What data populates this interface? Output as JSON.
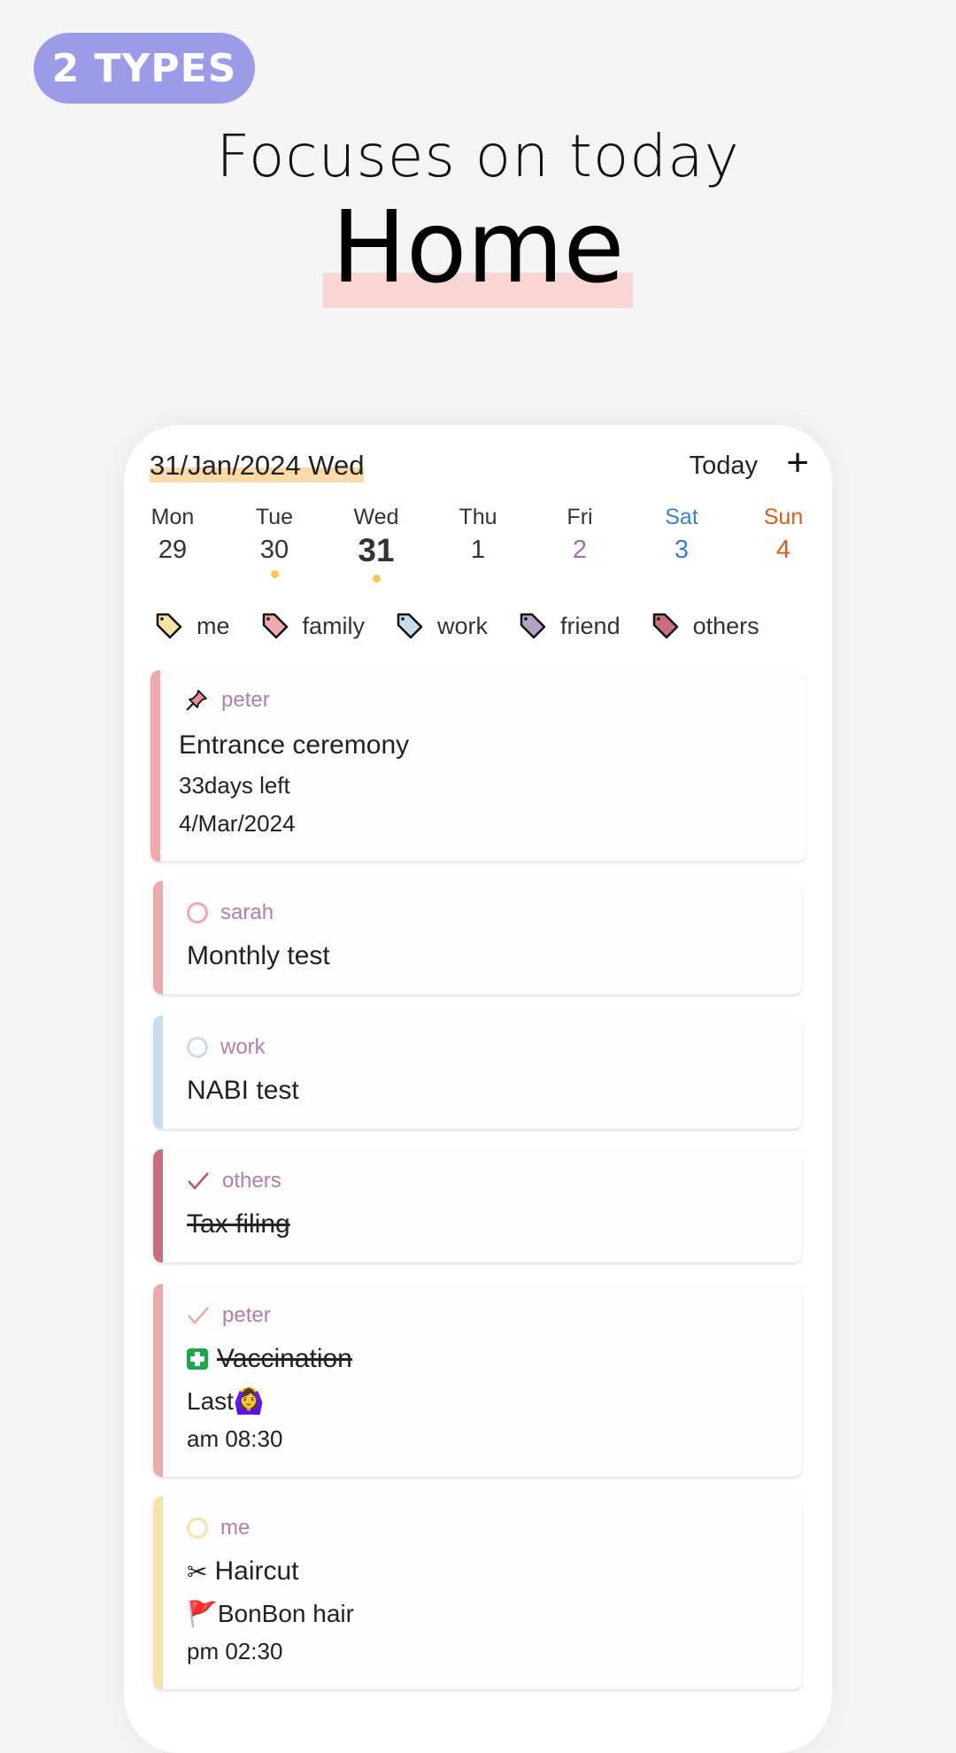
{
  "badge": "2 TYPES",
  "subtitle": "Focuses on today",
  "title": "Home",
  "colors": {
    "badge_bg": "#9c9be8",
    "title_highlight": "#f9d6d4",
    "date_highlight": "#fad9a8",
    "sat": "#3a7fd4",
    "sun": "#e05a1e",
    "fri": "#a86e9f",
    "dot": "#f5c84c",
    "owner_text": "#b27fa8"
  },
  "header": {
    "date": "31/Jan/2024 Wed",
    "today_label": "Today",
    "add_icon": "plus-icon"
  },
  "week": [
    {
      "name": "Mon",
      "num": "29",
      "dot": false
    },
    {
      "name": "Tue",
      "num": "30",
      "dot": true
    },
    {
      "name": "Wed",
      "num": "31",
      "dot": true,
      "current": true
    },
    {
      "name": "Thu",
      "num": "1",
      "dot": false
    },
    {
      "name": "Fri",
      "num": "2",
      "dot": false
    },
    {
      "name": "Sat",
      "num": "3",
      "dot": false
    },
    {
      "name": "Sun",
      "num": "4",
      "dot": false
    }
  ],
  "tags": [
    {
      "label": "me",
      "color": "#f7e3a8"
    },
    {
      "label": "family",
      "color": "#f2a9ab"
    },
    {
      "label": "work",
      "color": "#c7dcec"
    },
    {
      "label": "friend",
      "color": "#b3a3c7"
    },
    {
      "label": "others",
      "color": "#cd6e7d"
    }
  ],
  "cards": [
    {
      "status_icon": "pin-icon",
      "owner": "peter",
      "title": "Entrance ceremony",
      "line2": "33days left",
      "line3": "4/Mar/2024",
      "stripe": "#f0a9ab"
    },
    {
      "status_icon": "circle-icon",
      "owner": "sarah",
      "title": "Monthly test",
      "stripe": "#f0a9ab"
    },
    {
      "status_icon": "circle-icon",
      "owner": "work",
      "title": "NABI test",
      "stripe": "#c7dcec"
    },
    {
      "status_icon": "check-icon",
      "owner": "others",
      "title": "Tax filing",
      "done": true,
      "stripe": "#cd6e7d"
    },
    {
      "status_icon": "check-icon",
      "owner": "peter",
      "title_emoji": "➕",
      "title": "Vaccination",
      "line2": "Last🙆‍♀️",
      "line3": "am 08:30",
      "done": true,
      "stripe": "#f0a9ab"
    },
    {
      "status_icon": "circle-icon",
      "owner": "me",
      "title_emoji": "✂",
      "title": "Haircut",
      "line2": "🚩BonBon hair",
      "line3": "pm 02:30",
      "stripe": "#f5e2a5"
    }
  ]
}
